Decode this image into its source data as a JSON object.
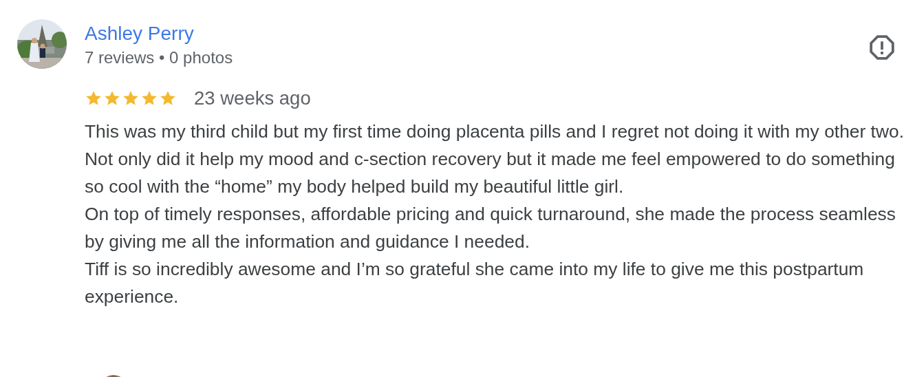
{
  "review": {
    "author": "Ashley Perry",
    "meta": "7 reviews • 0 photos",
    "stars": 5,
    "time": "23 weeks ago",
    "paragraphs": [
      "This was my third child but my first time doing placenta pills and I regret not doing it with my other two. Not only did it help my mood and c-section recovery but it made me feel empowered to do something so cool with the “home” my body helped build my beautiful little girl.",
      "On top of timely responses, affordable pricing and quick turnaround, she made the process seamless by giving me all the information and guidance I needed.",
      "Tiff is so incredibly awesome and I’m so grateful she came into my life to give me this postpartum experience."
    ]
  }
}
